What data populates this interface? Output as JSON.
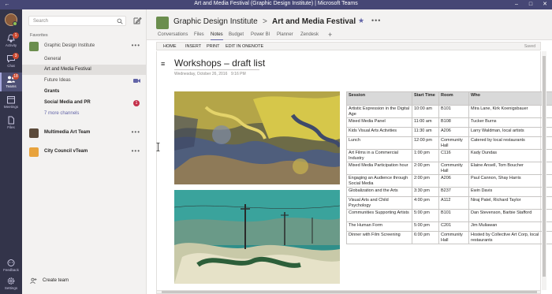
{
  "window": {
    "title": "Art and Media Festival (Graphic Design Institute) | Microsoft Teams",
    "controls": [
      "back-icon",
      "minimize-icon",
      "maximize-icon",
      "close-icon"
    ]
  },
  "appbar": {
    "items": [
      {
        "label": "Activity",
        "icon": "bell-icon",
        "badge": "1"
      },
      {
        "label": "Chat",
        "icon": "chat-icon",
        "badge": "3"
      },
      {
        "label": "Teams",
        "icon": "teams-icon",
        "badge": "18"
      },
      {
        "label": "Meetings",
        "icon": "calendar-icon",
        "badge": ""
      },
      {
        "label": "Files",
        "icon": "files-icon",
        "badge": ""
      },
      {
        "label": "Feedback",
        "icon": "feedback-icon",
        "badge": ""
      },
      {
        "label": "Settings",
        "icon": "gear-icon",
        "badge": ""
      }
    ]
  },
  "sidebar": {
    "search_placeholder": "Search",
    "favorites_label": "Favorites",
    "team1": {
      "name": "Graphic Design Institute",
      "more": "•••"
    },
    "channels": [
      {
        "name": "General"
      },
      {
        "name": "Art and Media Festival"
      },
      {
        "name": "Future Ideas"
      },
      {
        "name": "Grants"
      },
      {
        "name": "Social Media and PR",
        "badge": "1"
      },
      {
        "name": "7 more channels"
      }
    ],
    "team2": {
      "name": "Multimedia Art Team",
      "more": "•••"
    },
    "team3": {
      "name": "City Council vTeam",
      "more": "•••"
    },
    "create_team": "Create team"
  },
  "header": {
    "team": "Graphic Design Institute",
    "separator": ">",
    "channel": "Art and Media Festival",
    "star": "★",
    "more": "•••",
    "tabs": [
      "Conversations",
      "Files",
      "Notes",
      "Budget",
      "Power BI",
      "Planner",
      "Zendesk"
    ],
    "active_tab": "Notes",
    "add_tab": "+"
  },
  "onenote": {
    "ribbon": [
      "HOME",
      "INSERT",
      "PRINT",
      "EDIT IN ONENOTE"
    ],
    "saved": "Saved",
    "page_title": "Workshops – draft list",
    "date": "Wednesday, October 26, 2016",
    "time": "9:16 PM",
    "table": {
      "headers": [
        "Session",
        "Start Time",
        "Room",
        "Who"
      ],
      "rows": [
        [
          "Artistic Expression in the Digital Age",
          "10:00 am",
          "B101",
          "Mira Lane, Kirk Koenigsbauer"
        ],
        [
          "Mixed Media Panel",
          "11:00 am",
          "B108",
          "Tucker Burns"
        ],
        [
          "Kids Visual Arts Activities",
          "11:30 am",
          "A206",
          "Larry Waldman, local artists"
        ],
        [
          "Lunch",
          "12:00 pm",
          "Community Hall",
          "Catered by local restaurants"
        ],
        [
          "Art Films in a Commercial Industry",
          "1:00 pm",
          "C116",
          "Kady Dundas"
        ],
        [
          "Mixed Media Participation hour",
          "2:00 pm",
          "Community Hall",
          "Elaine Ansell, Tom Boucher"
        ],
        [
          "Engaging an Audience through Social Media",
          "2:00 pm",
          "A206",
          "Paul Cannon, Shay Harris"
        ],
        [
          "Globalization and the Arts",
          "3:30 pm",
          "B237",
          "Ewin Davis"
        ],
        [
          "Visual Arts and Child Psychology",
          "4:00 pm",
          "A112",
          "Niraj Patel, Richard Taylor"
        ],
        [
          "Communities Supporting Artists",
          "5:00 pm",
          "B101",
          "Dan Stevenson, Barbie Stafford"
        ],
        [
          "The Human Form",
          "5:00 pm",
          "C201",
          "Jim Muliawan"
        ],
        [
          "Dinner with Film Screening",
          "6:00 pm",
          "Community Hall",
          "Hosted by Collective Art Corp, local restaurants"
        ]
      ]
    }
  },
  "colors": {
    "accent": "#6264a7",
    "titlebar": "#464775",
    "appbar": "#33344a",
    "badge": "#c4314b"
  }
}
